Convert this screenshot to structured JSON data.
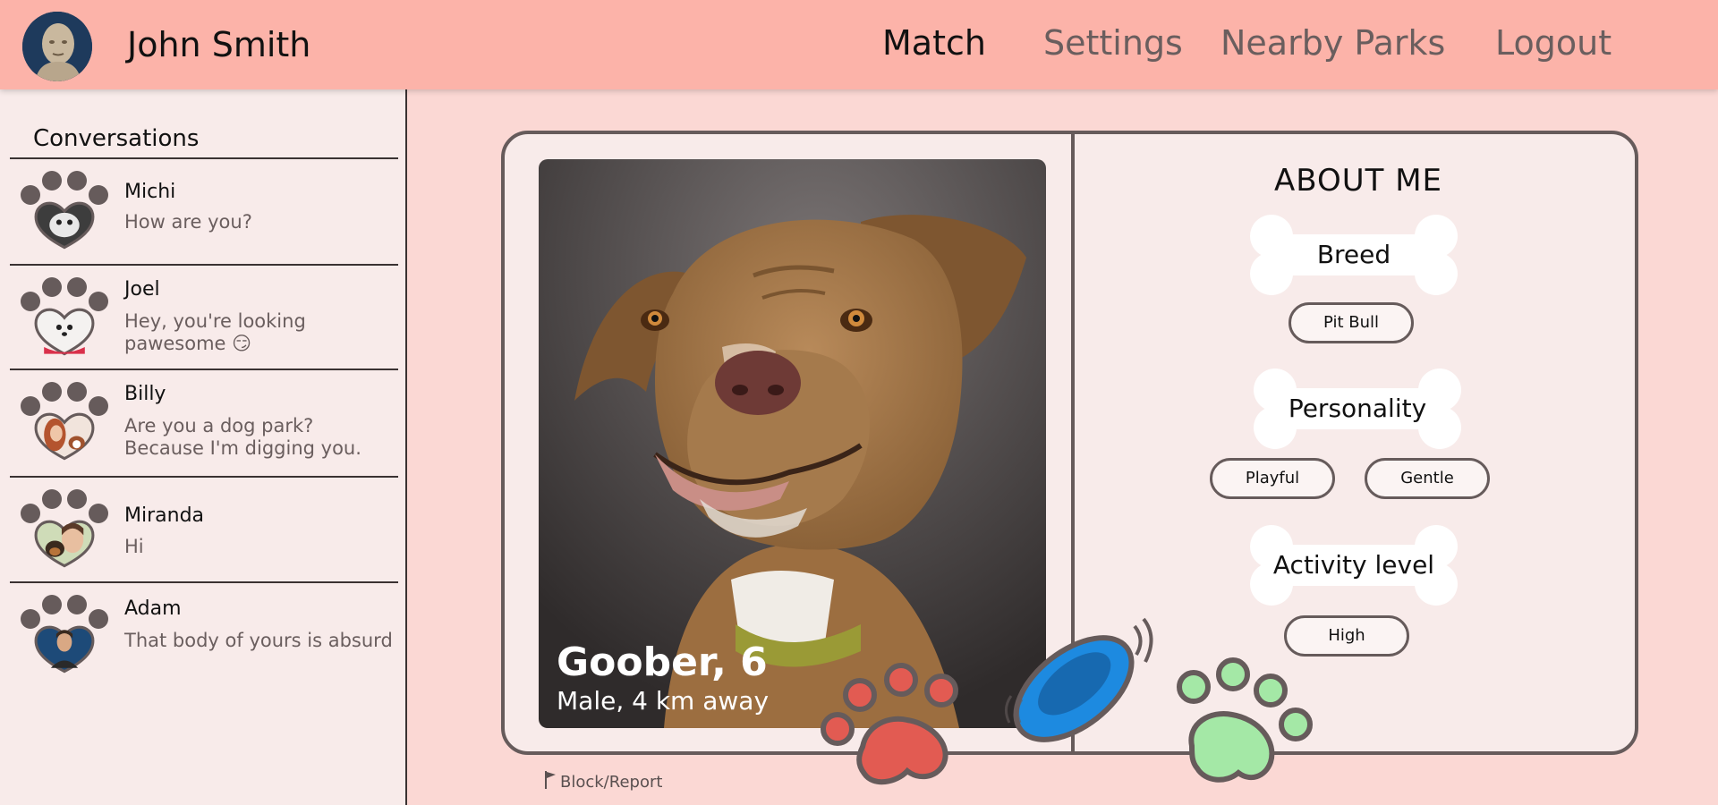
{
  "header": {
    "user_name": "John Smith",
    "nav": {
      "match": "Match",
      "settings": "Settings",
      "nearby_parks": "Nearby Parks",
      "logout": "Logout"
    }
  },
  "sidebar": {
    "title": "Conversations",
    "conversations": [
      {
        "name": "Michi",
        "message": "How are you?"
      },
      {
        "name": "Joel",
        "message": "Hey, you're looking pawesome 😏"
      },
      {
        "name": "Billy",
        "message": "Are you a dog park? Because I'm digging you."
      },
      {
        "name": "Miranda",
        "message": "Hi"
      },
      {
        "name": "Adam",
        "message": "That body of yours is absurd"
      }
    ]
  },
  "profile": {
    "name_age": "Goober, 6",
    "details": "Male, 4 km away"
  },
  "about": {
    "title": "ABOUT ME",
    "breed_label": "Breed",
    "breed_value": "Pit Bull",
    "personality_label": "Personality",
    "personality_values": [
      "Playful",
      "Gentle"
    ],
    "activity_label": "Activity level",
    "activity_value": "High"
  },
  "actions": {
    "block_report": "Block/Report"
  },
  "colors": {
    "header_bg": "#fcb3a9",
    "page_bg": "#fbd8d4",
    "panel_bg": "#f8ebea",
    "outline": "#665b5b",
    "paw_gray": "#665b5b",
    "paw_red": "#e25b52",
    "paw_green": "#a4e8a6",
    "frisbee_blue": "#1d8ae0"
  },
  "icons": [
    "avatar",
    "paw-icon",
    "frisbee-icon",
    "flag-icon",
    "bone-icon"
  ]
}
